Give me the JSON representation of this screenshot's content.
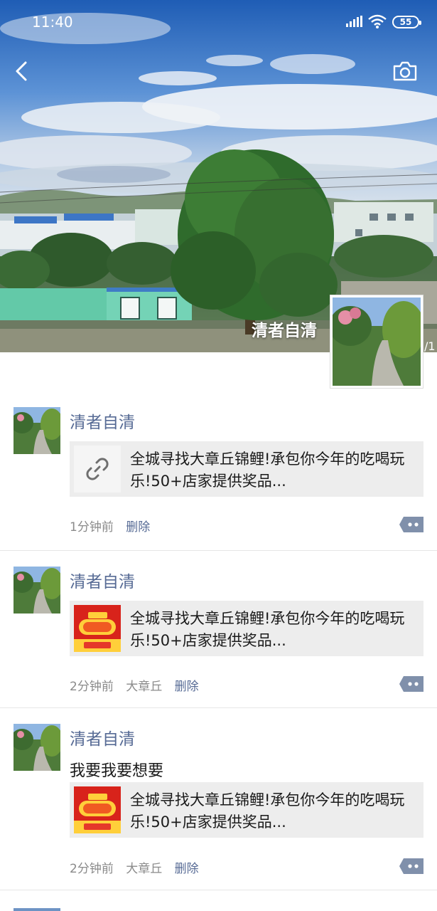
{
  "status_bar": {
    "time": "11:40",
    "battery": "55"
  },
  "header": {
    "owner_name": "清者自清",
    "edge_text": "/1"
  },
  "icons": {
    "back": "chevron-left-icon",
    "camera": "camera-icon",
    "link": "link-icon",
    "more": "more-dots-icon"
  },
  "colors": {
    "name_link": "#576b95",
    "meta_gray": "#8a8a8a",
    "card_bg": "#ededed"
  },
  "posts": [
    {
      "name": "清者自清",
      "text": "",
      "share_text": "全城寻找大章丘锦鲤!承包你今年的吃喝玩乐!50+店家提供奖品...",
      "share_thumb": "link-icon",
      "time": "1分钟前",
      "location": "",
      "delete_label": "删除"
    },
    {
      "name": "清者自清",
      "text": "",
      "share_text": "全城寻找大章丘锦鲤!承包你今年的吃喝玩乐!50+店家提供奖品...",
      "share_thumb": "koi-image",
      "time": "2分钟前",
      "location": "大章丘",
      "delete_label": "删除"
    },
    {
      "name": "清者自清",
      "text": "我要我要想要",
      "share_text": "全城寻找大章丘锦鲤!承包你今年的吃喝玩乐!50+店家提供奖品...",
      "share_thumb": "koi-image",
      "time": "2分钟前",
      "location": "大章丘",
      "delete_label": "删除"
    }
  ]
}
